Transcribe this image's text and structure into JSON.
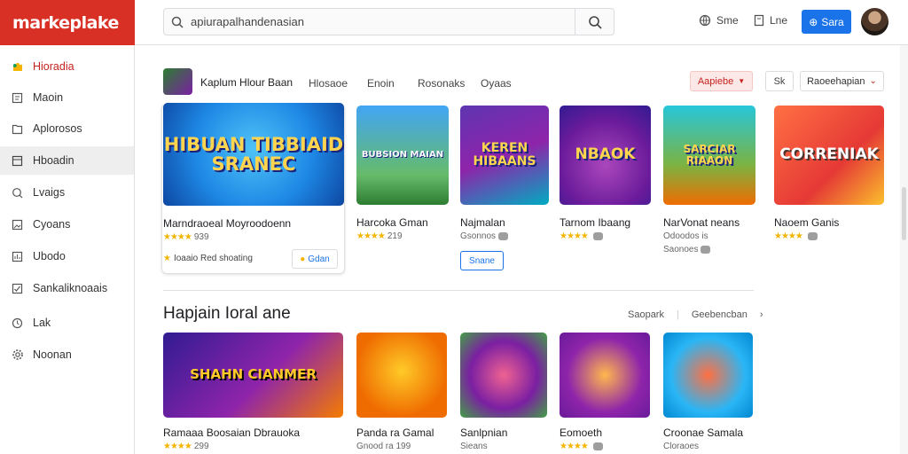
{
  "brand": {
    "logo": "markeplake"
  },
  "search": {
    "query": "apiurapalhandenasian"
  },
  "topbar": {
    "link1": "Sme",
    "link2": "Lne",
    "button": "Sara"
  },
  "sidebar": {
    "items": [
      {
        "label": "Hioradia",
        "icon": "puzzle-icon"
      },
      {
        "label": "Maoin",
        "icon": "document-icon"
      },
      {
        "label": "Aplorosos",
        "icon": "book-icon"
      },
      {
        "label": "Hboadin",
        "icon": "grid-icon"
      },
      {
        "label": "Lvaigs",
        "icon": "search-icon"
      },
      {
        "label": "Cyoans",
        "icon": "gallery-icon"
      },
      {
        "label": "Ubodo",
        "icon": "chart-icon"
      },
      {
        "label": "Sankaliknoaais",
        "icon": "check-icon"
      },
      {
        "label": "Lak",
        "icon": "clock-icon"
      },
      {
        "label": "Noonan",
        "icon": "gear-icon"
      }
    ]
  },
  "featured": {
    "title": "Kaplum Hlour Baan",
    "tabs": [
      "Hlosaoe",
      "Enoin",
      "Rosonaks",
      "Oyaas"
    ],
    "filter_primary": "Aapiebe",
    "filter_small": "Sk",
    "filter_select": "Raoeehapian"
  },
  "row1": [
    {
      "art": "HIBUAN TIBBIAID SRANEC",
      "name": "Marndraoeal Moyroodoenn",
      "rating": "939",
      "extra": "Ioaaio Red shoating",
      "action": "Gdan"
    },
    {
      "art": "BUBSION MAIAN",
      "name": "Harcoka Gman",
      "rating": "219"
    },
    {
      "art": "KEREN HIBAANS",
      "name": "Najmalan",
      "rating": "Gsonnos",
      "action": "Snane"
    },
    {
      "art": "NBAOK",
      "name": "Tarnom Ibaang",
      "rating": ""
    },
    {
      "art": "SARCIAR RIAAON",
      "name": "NarVonat neans",
      "rating": "Odoodos is",
      "rating2": "Saonoes"
    },
    {
      "art": "CORRENIAK",
      "name": "Naoem Ganis",
      "rating": ""
    }
  ],
  "section2": {
    "title": "Hapjain Ioral ane",
    "link1": "Saopark",
    "link2": "Geebencban"
  },
  "row2": [
    {
      "art": "SHAHN CIANMER",
      "name": "Ramaaa Boosaian Dbrauoka",
      "rating": "299"
    },
    {
      "art": "",
      "name": "Panda ra Gamal",
      "rating": "Gnood ra 199"
    },
    {
      "art": "",
      "name": "Sanlpnian",
      "rating": "Sieans"
    },
    {
      "art": "",
      "name": "Eomoeth",
      "rating": ""
    },
    {
      "art": "",
      "name": "Croonae Samala",
      "rating": "Cloraoes"
    }
  ],
  "colors": {
    "brand": "#d93025",
    "accent": "#1a73e8",
    "star": "#f4b400"
  }
}
